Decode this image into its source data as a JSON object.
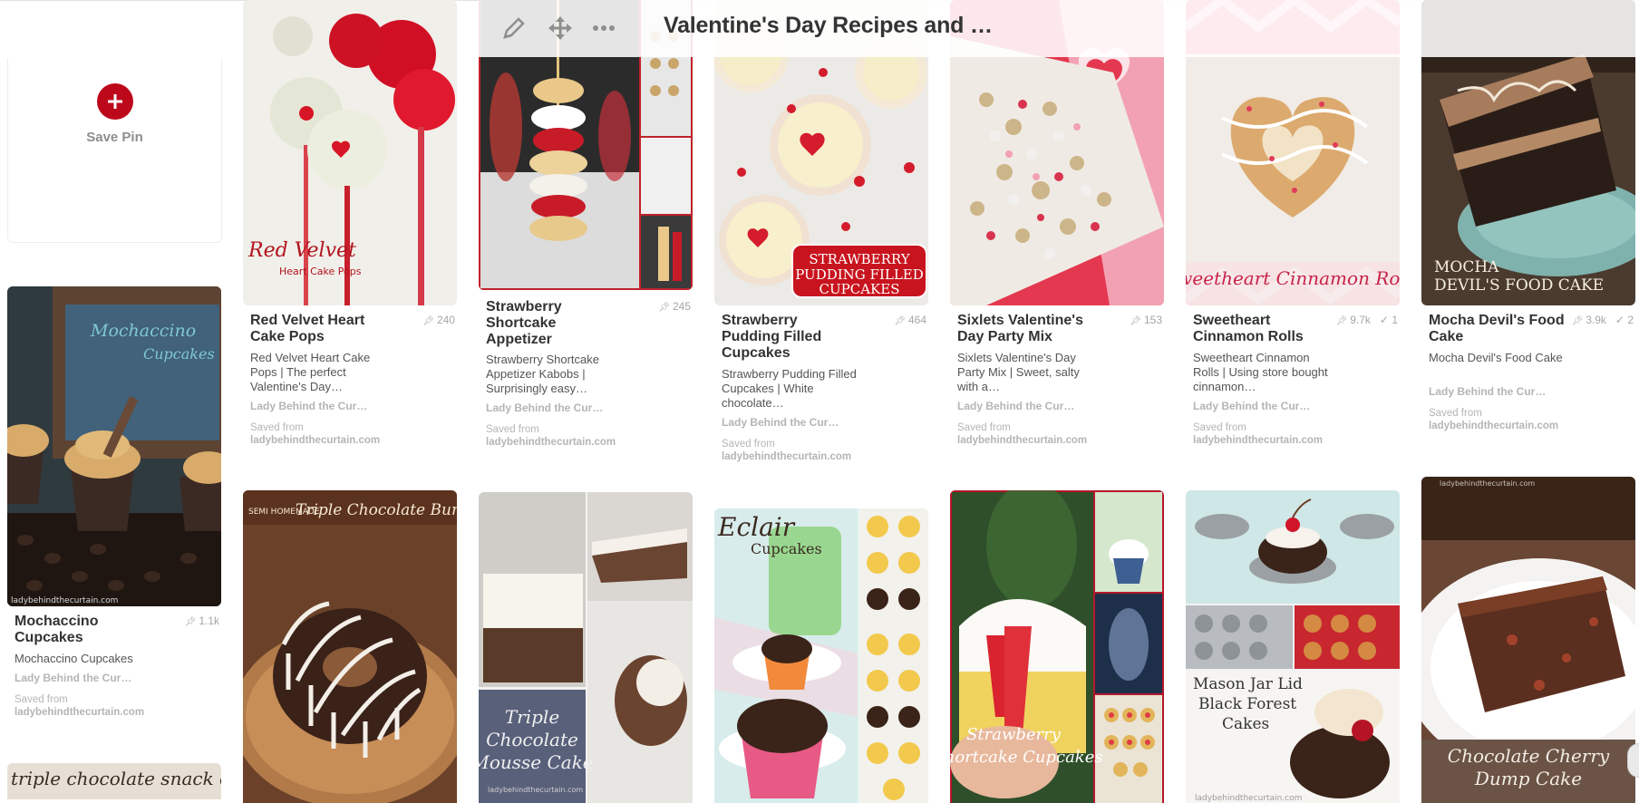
{
  "board": {
    "title": "Valentine's Day Recipes and …",
    "icons": [
      "pencil-icon",
      "move-icon",
      "more-icon"
    ]
  },
  "save_pin": {
    "label": "Save Pin"
  },
  "pins": [
    {
      "title": "Red Velvet Heart Cake Pops",
      "repins": "240",
      "desc": "Red Velvet Heart Cake Pops | The perfect Valentine's Day…",
      "source": "Lady Behind the Cur…",
      "saved_from": "Saved from",
      "domain": "ladybehindthecurtain.com",
      "image_text": [
        "Red Velvet",
        "Heart Cake Pops"
      ]
    },
    {
      "title": "Strawberry Shortcake Appetizer",
      "repins": "245",
      "desc": "Strawberry Shortcake Appetizer Kabobs | Surprisingly easy…",
      "source": "Lady Behind the Cur…",
      "saved_from": "Saved from",
      "domain": "ladybehindthecurtain.com"
    },
    {
      "title": "Strawberry Pudding Filled Cupcakes",
      "repins": "464",
      "desc": "Strawberry Pudding Filled Cupcakes | White chocolate…",
      "source": "Lady Behind the Cur…",
      "saved_from": "Saved from",
      "domain": "ladybehindthecurtain.com",
      "image_text": [
        "STRAWBERRY",
        "PUDDING FILLED",
        "CUPCAKES"
      ]
    },
    {
      "title": "Sixlets Valentine's Day Party Mix",
      "repins": "153",
      "desc": "Sixlets Valentine's Day Party Mix | Sweet, salty with a…",
      "source": "Lady Behind the Cur…",
      "saved_from": "Saved from",
      "domain": "ladybehindthecurtain.com"
    },
    {
      "title": "Sweetheart Cinnamon Rolls",
      "repins": "9.7k",
      "likes": "1",
      "desc": "Sweetheart Cinnamon Rolls | Using store bought cinnamon…",
      "source": "Lady Behind the Cur…",
      "saved_from": "Saved from",
      "domain": "ladybehindthecurtain.com",
      "image_text": [
        "Sweetheart Cinnamon Rolls"
      ]
    },
    {
      "title": "Mocha Devil's Food Cake",
      "repins": "3.9k",
      "likes": "2",
      "desc": "Mocha Devil's Food Cake",
      "source": "Lady Behind the Cur…",
      "saved_from": "Saved from",
      "domain": "ladybehindthecurtain.com",
      "image_text": [
        "MOCHA",
        "DEVIL'S FOOD CAKE"
      ]
    },
    {
      "title": "Mochaccino Cupcakes",
      "repins": "1.1k",
      "desc": "Mochaccino Cupcakes",
      "source": "Lady Behind the Cur…",
      "saved_from": "Saved from",
      "domain": "ladybehindthecurtain.com",
      "image_text": [
        "Mochaccino",
        "Cupcakes",
        "ladybehindthecurtain.com"
      ]
    }
  ],
  "image_pins": [
    {
      "image_text": [
        "SEMI HOMEMADE",
        "Triple Chocolate Bundt Cake"
      ]
    },
    {
      "image_text": [
        "Triple",
        "Chocolate",
        "Mousse Cake",
        "ladybehindthecurtain.com"
      ]
    },
    {
      "image_text": [
        "Eclair",
        "Cupcakes"
      ]
    },
    {
      "image_text": [
        "Strawberry",
        "Shortcake Cupcakes"
      ]
    },
    {
      "image_text": [
        "Mason Jar Lid",
        "Black Forest",
        "Cakes",
        "ladybehindthecurtain.com"
      ]
    },
    {
      "image_text": [
        "Chocolate Cherry",
        "Dump Cake",
        "ladybehindthecurtain.com"
      ]
    },
    {
      "image_text": [
        "triple chocolate snack cake"
      ]
    }
  ]
}
